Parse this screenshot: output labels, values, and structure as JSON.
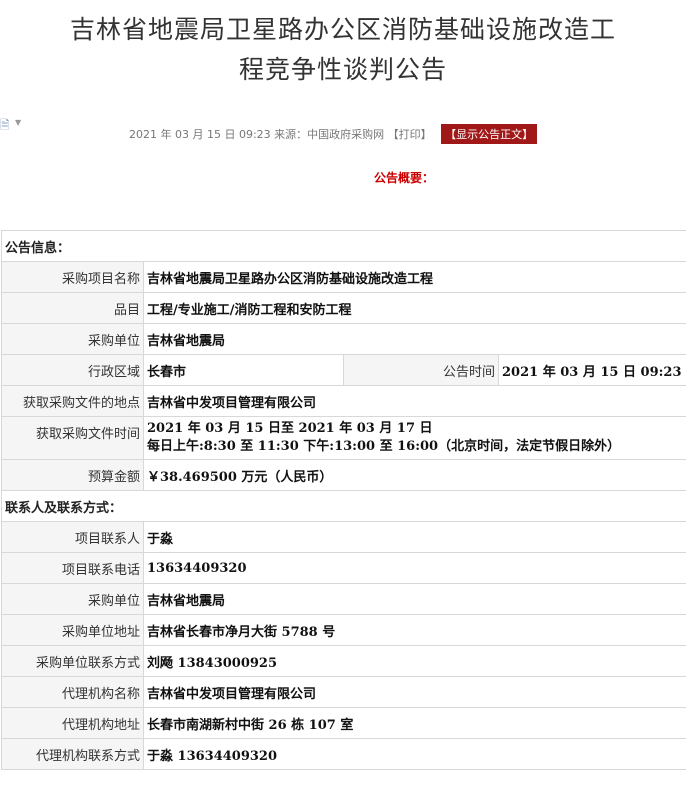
{
  "title_lines": [
    "吉林省地震局卫星路办公区消防基础设施改造工",
    "程竞争性谈判公告"
  ],
  "meta": {
    "date_source": "2021 年 03 月 15 日  09:23 来源：中国政府采购网",
    "print_label": "【打印】",
    "show_label": "【显示公告正文】"
  },
  "summary_label": "公告概要：",
  "sections": {
    "notice_info": "公告信息：",
    "contact_info": "联系人及联系方式："
  },
  "rows": {
    "project_name": {
      "label": "采购项目名称",
      "value": "吉林省地震局卫星路办公区消防基础设施改造工程"
    },
    "category": {
      "label": "品目",
      "value": "工程/专业施工/消防工程和安防工程"
    },
    "purchaser": {
      "label": "采购单位",
      "value": "吉林省地震局"
    },
    "region": {
      "label": "行政区域",
      "value": "长春市"
    },
    "notice_time": {
      "label": "公告时间",
      "value": "2021 年 03 月 15 日  09:23"
    },
    "doc_location": {
      "label": "获取采购文件的地点",
      "value": "吉林省中发项目管理有限公司"
    },
    "doc_time": {
      "label": "获取采购文件时间",
      "value_line1": "2021 年 03 月 15 日至 2021 年 03 月 17 日",
      "value_line2": "每日上午:8:30  至  11:30     下午:13:00  至  16:00（北京时间，法定节假日除外）"
    },
    "budget": {
      "label": "预算金额",
      "value": "￥38.469500 万元（人民币）"
    },
    "project_contact": {
      "label": "项目联系人",
      "value": "于淼"
    },
    "project_phone": {
      "label": "项目联系电话",
      "value": "13634409320"
    },
    "purchaser2": {
      "label": "采购单位",
      "value": "吉林省地震局"
    },
    "purchaser_address": {
      "label": "采购单位地址",
      "value": "吉林省长春市净月大街 5788 号"
    },
    "purchaser_contact": {
      "label": "采购单位联系方式",
      "value": "刘飏  13843000925"
    },
    "agency_name": {
      "label": "代理机构名称",
      "value": "吉林省中发项目管理有限公司"
    },
    "agency_address": {
      "label": "代理机构地址",
      "value": "长春市南湖新村中街 26 栋 107 室"
    },
    "agency_contact": {
      "label": "代理机构联系方式",
      "value": "于淼  13634409320"
    }
  }
}
